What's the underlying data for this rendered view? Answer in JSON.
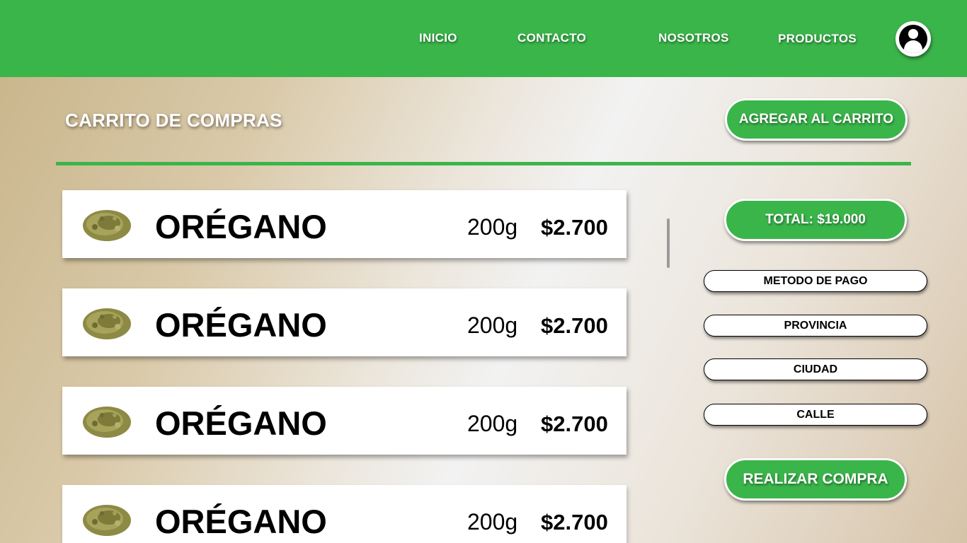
{
  "nav": {
    "links": [
      "INICIO",
      "CONTACTO",
      "NOSOTROS",
      "PRODUCTOS"
    ],
    "avatar_icon": "user-circle-icon"
  },
  "cart": {
    "title": "CARRITO DE COMPRAS",
    "add_button": "AGREGAR AL CARRITO",
    "items": [
      {
        "image_icon": "oregano-image",
        "name": "ORÉGANO",
        "weight": "200g",
        "price": "$2.700"
      },
      {
        "image_icon": "oregano-image",
        "name": "ORÉGANO",
        "weight": "200g",
        "price": "$2.700"
      },
      {
        "image_icon": "oregano-image",
        "name": "ORÉGANO",
        "weight": "200g",
        "price": "$2.700"
      },
      {
        "image_icon": "oregano-image",
        "name": "ORÉGANO",
        "weight": "200g",
        "price": "$2.700"
      }
    ]
  },
  "checkout": {
    "total": "TOTAL: $19.000",
    "fields": [
      "METODO DE PAGO",
      "PROVINCIA",
      "CIUDAD",
      "CALLE"
    ],
    "submit_button": "REALIZAR COMPRA"
  },
  "colors": {
    "accent": "#3ab54a",
    "white": "#ffffff",
    "text": "#000000"
  }
}
